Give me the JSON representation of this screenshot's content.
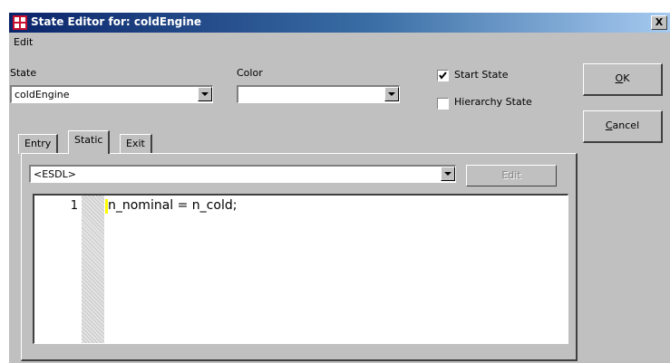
{
  "window": {
    "title": "State Editor for: coldEngine",
    "close_glyph": "X"
  },
  "menu": {
    "items": [
      {
        "label": "Edit"
      }
    ]
  },
  "state_field": {
    "label": "State",
    "value": "coldEngine"
  },
  "color_field": {
    "label": "Color",
    "value": ""
  },
  "checkboxes": {
    "start_state": {
      "label": "Start State",
      "checked": true
    },
    "hierarchy_state": {
      "label": "Hierarchy State",
      "checked": false
    }
  },
  "buttons": {
    "ok": "OK",
    "cancel": "Cancel"
  },
  "tabs": [
    {
      "label": "Entry",
      "active": false
    },
    {
      "label": "Static",
      "active": true
    },
    {
      "label": "Exit",
      "active": false
    }
  ],
  "language": {
    "value": "<ESDL>"
  },
  "edit_button": {
    "label": "Edit",
    "enabled": false
  },
  "code": {
    "lines": [
      {
        "number": "1",
        "text": "n_nominal = n_cold;"
      }
    ]
  },
  "colors": {
    "titlebar_start": "#0a246a",
    "titlebar_end": "#a6caf0",
    "face": "#c0c0c0",
    "line_marker": "#ffff00"
  },
  "icons": {
    "title": "state-editor-icon",
    "dropdown": "chevron-down-icon",
    "check": "checkmark-icon"
  }
}
